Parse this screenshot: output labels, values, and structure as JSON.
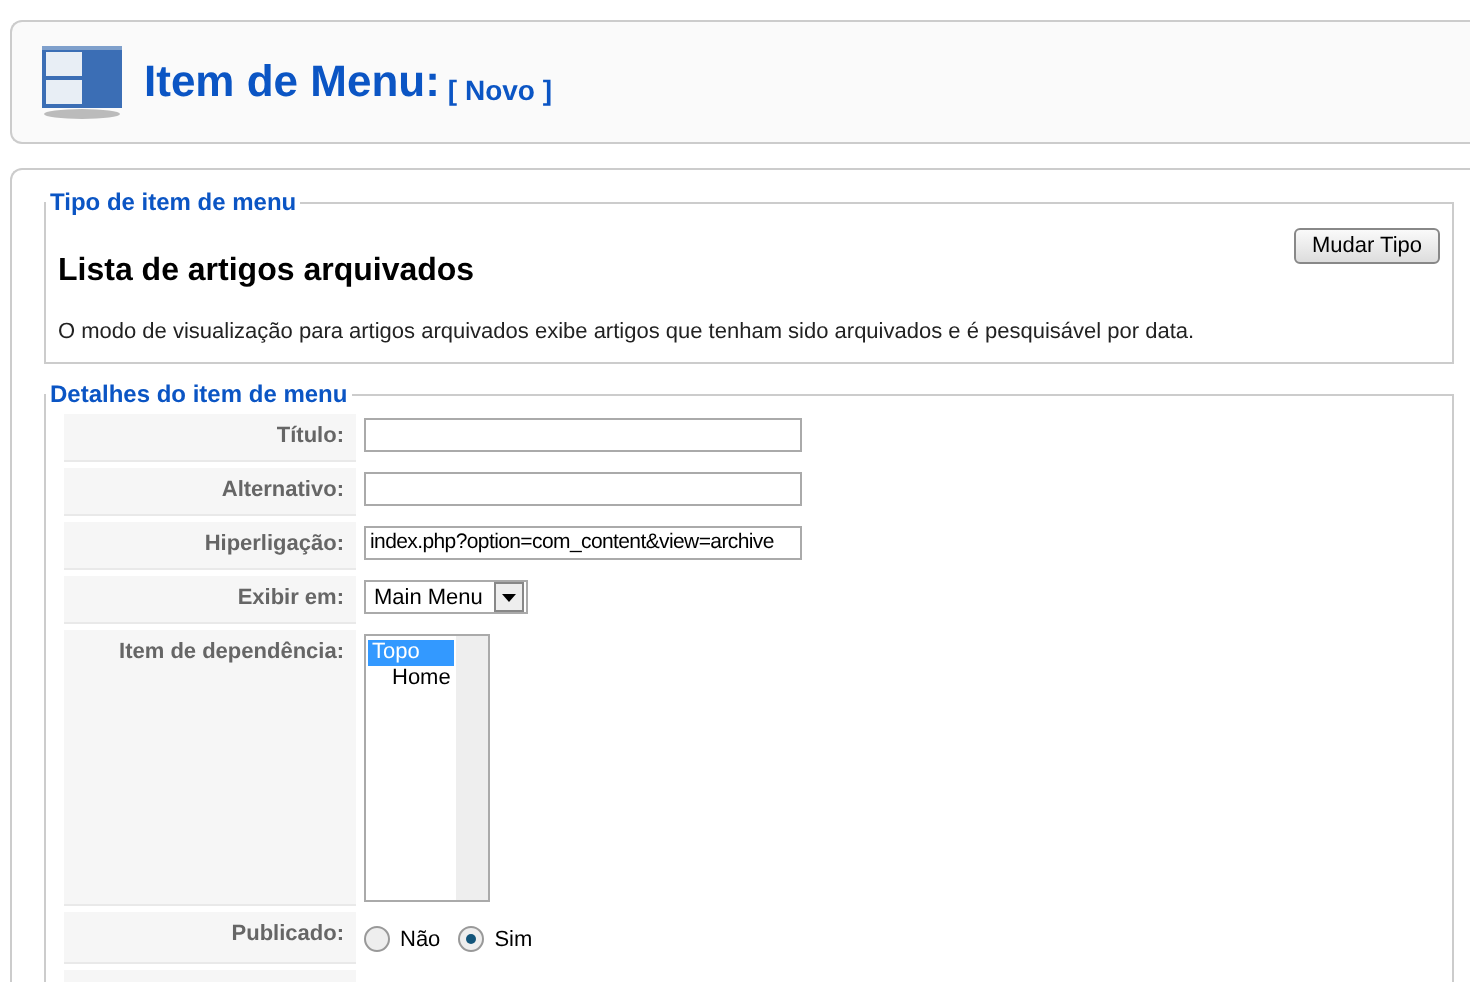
{
  "header": {
    "title": "Item de Menu:",
    "subtitle": "[ Novo ]"
  },
  "type_section": {
    "legend": "Tipo de item de menu",
    "name": "Lista de artigos arquivados",
    "description": "O modo de visualização para artigos arquivados exibe artigos que tenham sido arquivados e é pesquisável por data.",
    "button": "Mudar Tipo"
  },
  "details_section": {
    "legend": "Detalhes do item de menu",
    "fields": [
      {
        "kind": "text",
        "label": "Título:"
      },
      {
        "kind": "text",
        "label": "Alternativo:"
      },
      {
        "kind": "text",
        "label": "Hiperligação:",
        "value": "index.php?option=com_content&view=archive"
      },
      {
        "kind": "select",
        "label": "Exibir em:",
        "value": "Main Menu"
      },
      {
        "kind": "listbox",
        "label": "Item de dependência:",
        "options": [
          {
            "label": "Topo",
            "selected": true,
            "children": [
              {
                "label": "Home",
                "selected": false
              }
            ]
          }
        ]
      },
      {
        "kind": "radio",
        "label": "Publicado:",
        "options": [
          {
            "label": "Não",
            "selected": false
          },
          {
            "label": "Sim",
            "selected": true
          }
        ]
      }
    ]
  }
}
